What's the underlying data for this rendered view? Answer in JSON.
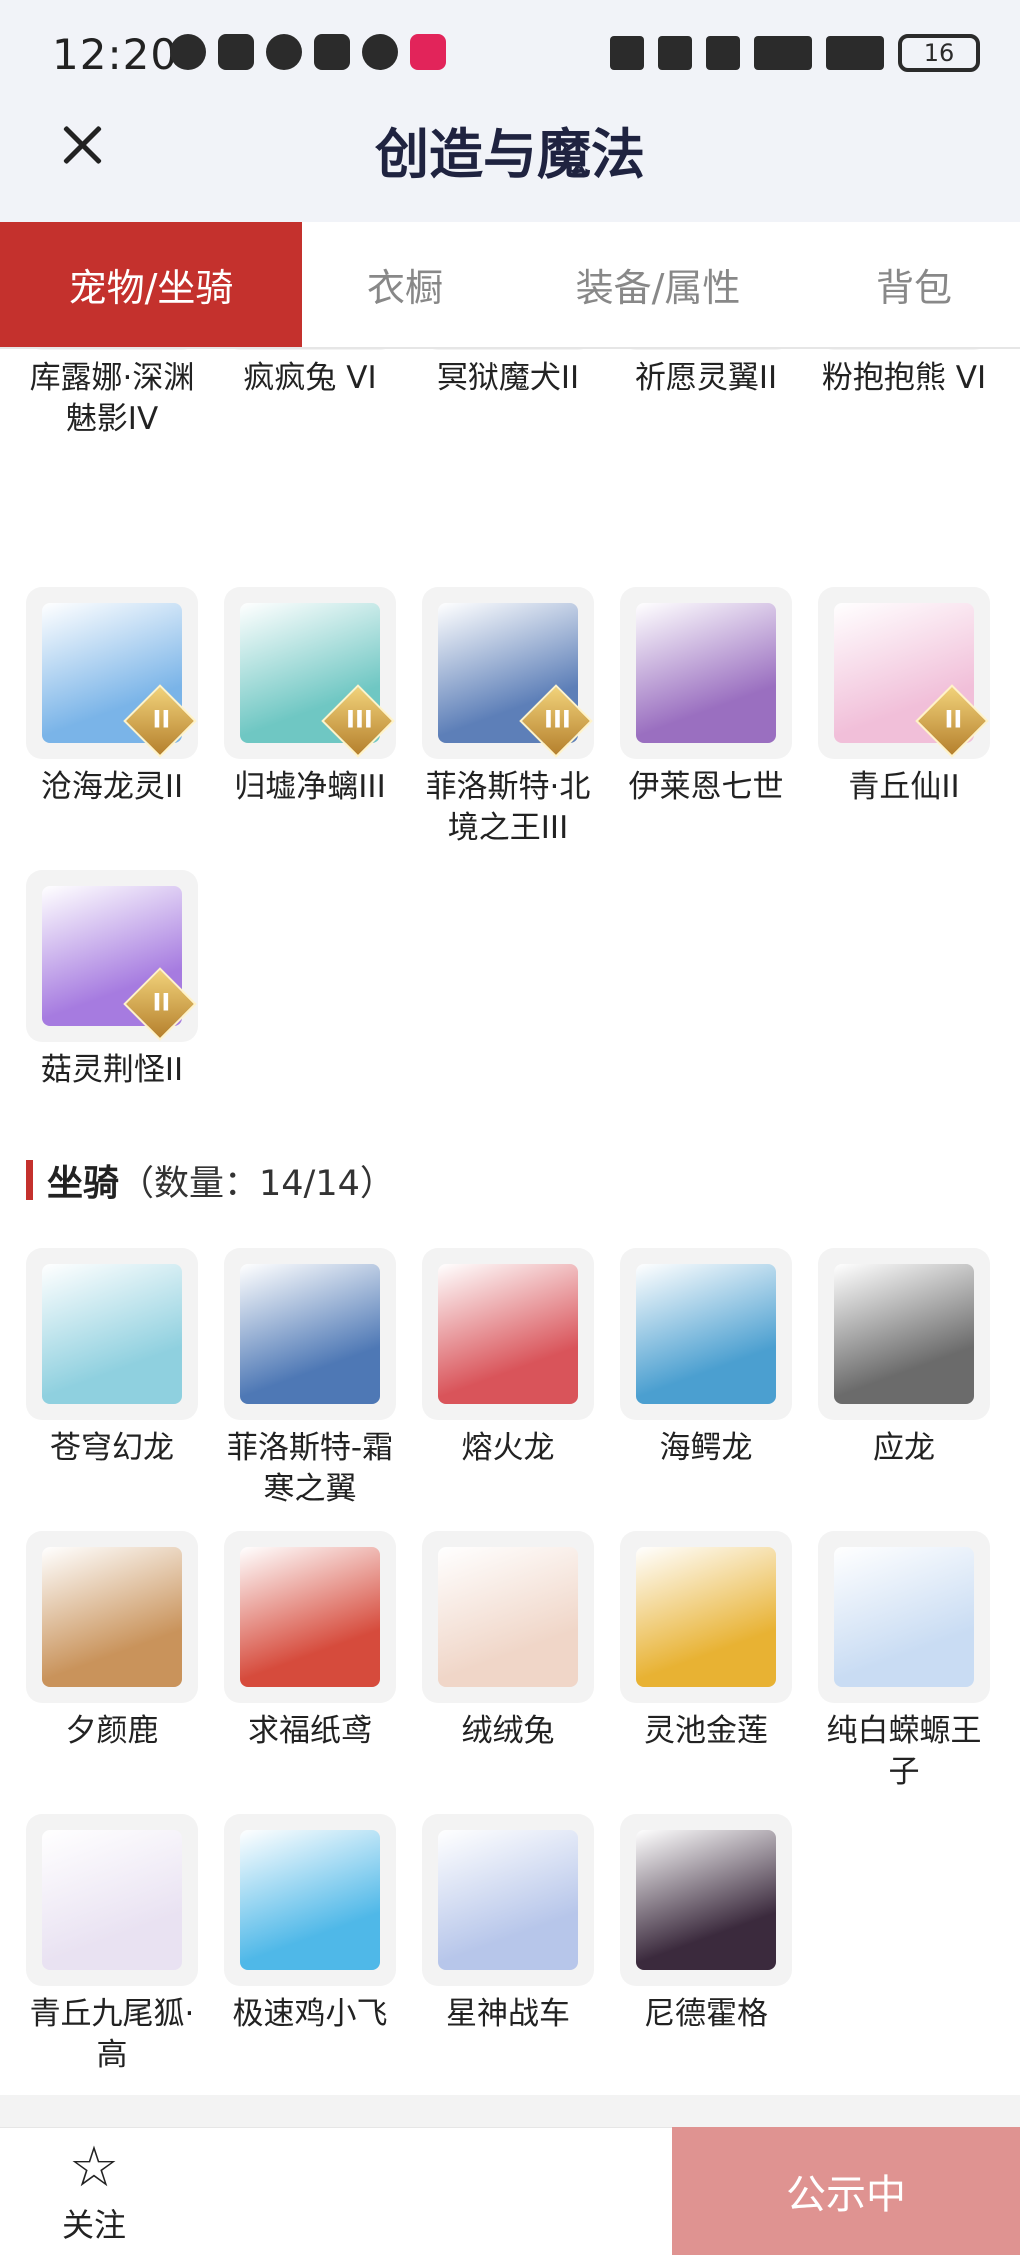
{
  "status": {
    "time": "12:20",
    "battery": "16"
  },
  "header": {
    "title": "创造与魔法"
  },
  "tabs": [
    "宠物/坐骑",
    "衣橱",
    "装备/属性",
    "背包"
  ],
  "pets_top": [
    {
      "name": "库露娜·深渊魅影IV",
      "badge": "IV",
      "color": "#d7c2ea"
    },
    {
      "name": "疯疯兔 VI",
      "badge": "VI",
      "color": "#f5c7cf"
    },
    {
      "name": "冥狱魔犬II",
      "badge": "II",
      "color": "#7a2c25"
    },
    {
      "name": "祈愿灵翼II",
      "badge": "II",
      "color": "#c66a2a"
    },
    {
      "name": "粉抱抱熊 VI",
      "badge": "VI",
      "color": "#f07aa0"
    }
  ],
  "pets_mid": [
    {
      "name": "沧海龙灵II",
      "badge": "II",
      "color": "#7ab4e8"
    },
    {
      "name": "归墟净螭III",
      "badge": "III",
      "color": "#6fc7c3"
    },
    {
      "name": "菲洛斯特·北境之王III",
      "badge": "III",
      "color": "#5d7fb8"
    },
    {
      "name": "伊莱恩七世",
      "badge": "",
      "color": "#9a6fc0"
    },
    {
      "name": "青丘仙II",
      "badge": "II",
      "color": "#f1bfd9"
    }
  ],
  "pets_last": [
    {
      "name": "菇灵荆怪II",
      "badge": "II",
      "color": "#a67be0"
    }
  ],
  "mount_section": {
    "title": "坐骑",
    "count": "（数量：14/14）"
  },
  "mounts": [
    {
      "name": "苍穹幻龙",
      "color": "#8fd0df"
    },
    {
      "name": "菲洛斯特-霜寒之翼",
      "color": "#4e78b5"
    },
    {
      "name": "熔火龙",
      "color": "#d9545a"
    },
    {
      "name": "海鳄龙",
      "color": "#4b9fd0"
    },
    {
      "name": "应龙",
      "color": "#6b6b6b"
    },
    {
      "name": "夕颜鹿",
      "color": "#c9935b"
    },
    {
      "name": "求福纸鸢",
      "color": "#d64b3c"
    },
    {
      "name": "绒绒兔",
      "color": "#f0d6c8"
    },
    {
      "name": "灵池金莲",
      "color": "#e8b233"
    },
    {
      "name": "纯白蝾螈王子",
      "color": "#c9dcf3"
    },
    {
      "name": "青丘九尾狐·高",
      "color": "#e9e2f2"
    },
    {
      "name": "极速鸡小飞",
      "color": "#4fb8e8"
    },
    {
      "name": "星神战车",
      "color": "#b7c6ea"
    },
    {
      "name": "尼德霍格",
      "color": "#3b2a3d"
    }
  ],
  "bottom": {
    "fav_label": "关注",
    "public_label": "公示中"
  }
}
